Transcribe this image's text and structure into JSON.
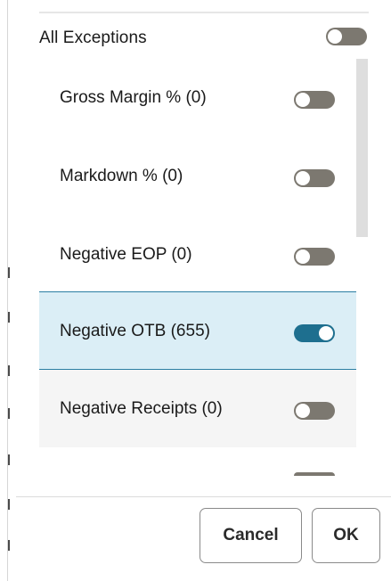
{
  "all_exceptions": {
    "label": "All Exceptions",
    "enabled": false
  },
  "items": [
    {
      "label": "Gross Margin % (0)",
      "enabled": false,
      "selected": false
    },
    {
      "label": "Markdown % (0)",
      "enabled": false,
      "selected": false
    },
    {
      "label": "Negative EOP (0)",
      "enabled": false,
      "selected": false
    },
    {
      "label": "Negative OTB (655)",
      "enabled": true,
      "selected": true
    },
    {
      "label": "Negative Receipts (0)",
      "enabled": false,
      "selected": false
    }
  ],
  "buttons": {
    "cancel_label": "Cancel",
    "ok_label": "OK"
  },
  "colors": {
    "toggle_on": "#1e6f8f",
    "toggle_off": "#7c7870",
    "selected_row_bg": "#dbeef6",
    "selected_row_border": "#2b7ea3"
  }
}
